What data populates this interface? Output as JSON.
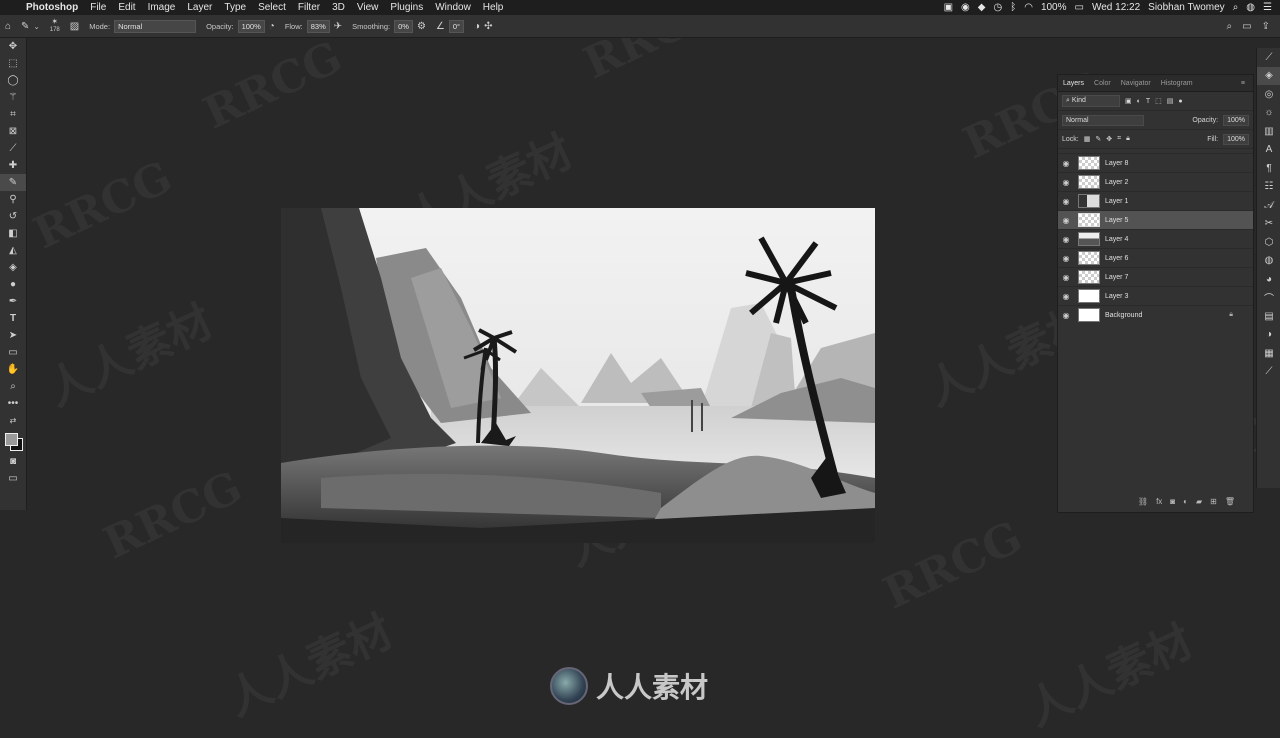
{
  "menubar": {
    "apple": "",
    "app": "Photoshop",
    "items": [
      "File",
      "Edit",
      "Image",
      "Layer",
      "Type",
      "Select",
      "Filter",
      "3D",
      "View",
      "Plugins",
      "Window",
      "Help"
    ],
    "battery": "100%",
    "clock": "Wed 12:22",
    "user": "Siobhan Twomey"
  },
  "options": {
    "brush_size": "178",
    "mode_label": "Mode:",
    "mode_value": "Normal",
    "opacity_label": "Opacity:",
    "opacity_value": "100%",
    "flow_label": "Flow:",
    "flow_value": "83%",
    "smoothing_label": "Smoothing:",
    "smoothing_value": "0%",
    "angle_value": "0°"
  },
  "layers_panel": {
    "tabs": [
      "Layers",
      "Color",
      "Navigator",
      "Histogram"
    ],
    "filter_value": "Kind",
    "blend_mode": "Normal",
    "opacity_label": "Opacity:",
    "opacity_value": "100%",
    "lock_label": "Lock:",
    "fill_label": "Fill:",
    "fill_value": "100%",
    "layers": [
      {
        "name": "Layer 8"
      },
      {
        "name": "Layer 2"
      },
      {
        "name": "Layer 1"
      },
      {
        "name": "Layer 5"
      },
      {
        "name": "Layer 4"
      },
      {
        "name": "Layer 6"
      },
      {
        "name": "Layer 7"
      },
      {
        "name": "Layer 3"
      },
      {
        "name": "Background"
      }
    ],
    "selected_layer": "Layer 5"
  },
  "watermark": {
    "text": "RRCG",
    "cn_text": "人人素材"
  }
}
